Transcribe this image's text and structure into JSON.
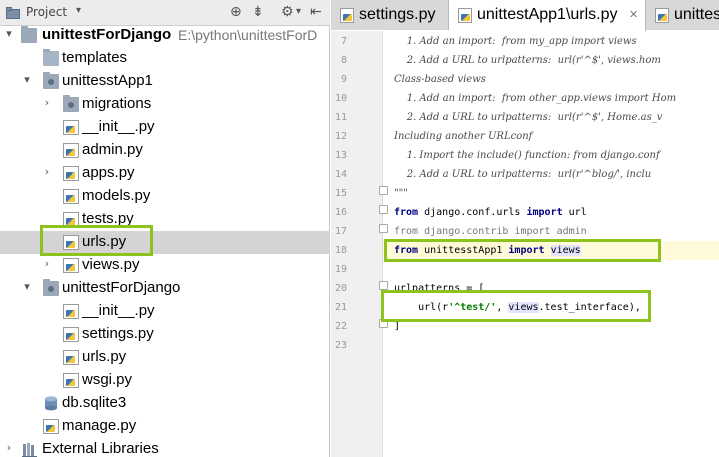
{
  "project_panel": {
    "title": "Project",
    "toolbar_icons": [
      "target-icon",
      "collapse-all-icon",
      "settings-icon",
      "hide-panel-icon"
    ],
    "tree": [
      {
        "label": "unittestForDjango",
        "path": "E:\\python\\unittestForD",
        "type": "root-folder",
        "expanded": true
      },
      {
        "label": "templates",
        "type": "folder"
      },
      {
        "label": "unittesstApp1",
        "type": "package",
        "expanded": true
      },
      {
        "label": "migrations",
        "type": "package",
        "expanded": false
      },
      {
        "label": "__init__.py",
        "type": "python-file"
      },
      {
        "label": "admin.py",
        "type": "python-file"
      },
      {
        "label": "apps.py",
        "type": "python-file"
      },
      {
        "label": "models.py",
        "type": "python-file"
      },
      {
        "label": "tests.py",
        "type": "python-file"
      },
      {
        "label": "urls.py",
        "type": "python-file",
        "selected": true
      },
      {
        "label": "views.py",
        "type": "python-file"
      },
      {
        "label": "unittestForDjango",
        "type": "package",
        "expanded": true
      },
      {
        "label": "__init__.py",
        "type": "python-file"
      },
      {
        "label": "settings.py",
        "type": "python-file"
      },
      {
        "label": "urls.py",
        "type": "python-file"
      },
      {
        "label": "wsgi.py",
        "type": "python-file"
      },
      {
        "label": "db.sqlite3",
        "type": "database-file"
      },
      {
        "label": "manage.py",
        "type": "python-file"
      },
      {
        "label": "External Libraries",
        "type": "libraries"
      }
    ]
  },
  "editor": {
    "tabs": [
      {
        "label": "settings.py",
        "active": false
      },
      {
        "label": "unittestApp1\\urls.py",
        "active": true
      },
      {
        "label": "unittest",
        "active": false
      }
    ],
    "line_numbers": [
      "7",
      "8",
      "9",
      "10",
      "11",
      "12",
      "13",
      "14",
      "15",
      "16",
      "17",
      "18",
      "19",
      "20",
      "21",
      "22",
      "23"
    ],
    "lines": {
      "l7": "    1. Add an import:  from my_app import views",
      "l8": "    2. Add a URL to urlpatterns:  url(r'^$', views.hom",
      "l9": "Class-based views",
      "l10": "    1. Add an import:  from other_app.views import Hom",
      "l11": "    2. Add a URL to urlpatterns:  url(r'^$', Home.as_v",
      "l12": "Including another URLconf",
      "l13": "    1. Import the include() function: from django.conf",
      "l14": "    2. Add a URL to urlpatterns:  url(r'^blog/', inclu",
      "l15": "\"\"\"",
      "l16_from": "from",
      "l16_mod": " django.conf.urls ",
      "l16_import": "import",
      "l16_name": " url",
      "l17_from": "from",
      "l17_mod": " django.contrib ",
      "l17_import": "import",
      "l17_name": " admin",
      "l18_from": "from",
      "l18_mod": " unittesstApp1 ",
      "l18_import": "import",
      "l18_name": "views",
      "l20": "urlpatterns = [",
      "l21_pre": "    url(r",
      "l21_str": "'^test/'",
      "l21_mid": ", ",
      "l21_views": "views",
      "l21_post": ".test_interface),",
      "l22": "]"
    }
  },
  "colors": {
    "highlight_box": "#8dc31e",
    "keyword": "#000080",
    "string": "#008000",
    "caret_row": "#fffbd8",
    "selection": "#d4d4d4"
  }
}
